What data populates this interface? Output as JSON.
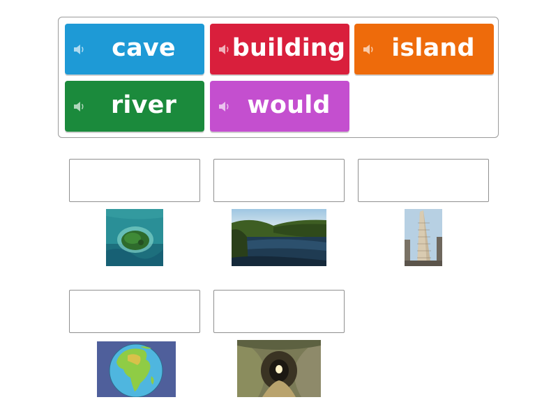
{
  "word_bank": {
    "tiles": [
      {
        "label": "cave",
        "color": "#1e9ad6",
        "icon": "speaker-icon"
      },
      {
        "label": "building",
        "color": "#d91f3c",
        "icon": "speaker-icon"
      },
      {
        "label": "island",
        "color": "#ee6b0b",
        "icon": "speaker-icon"
      },
      {
        "label": "river",
        "color": "#1b8a3c",
        "icon": "speaker-icon"
      },
      {
        "label": "would",
        "color": "#c44fcf",
        "icon": "speaker-icon"
      }
    ]
  },
  "targets": [
    {
      "image": "island-photo",
      "answer": ""
    },
    {
      "image": "river-photo",
      "answer": ""
    },
    {
      "image": "building-photo",
      "answer": ""
    },
    {
      "image": "world-globe-picture",
      "answer": ""
    },
    {
      "image": "cave-tunnel-photo",
      "answer": ""
    }
  ],
  "colors": {
    "border": "#8f8f8f",
    "background": "#ffffff"
  }
}
